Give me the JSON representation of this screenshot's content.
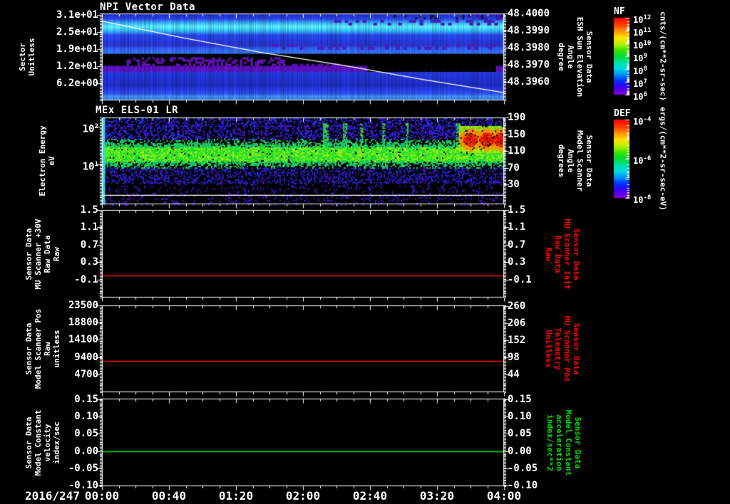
{
  "figure": {
    "background": "#000000"
  },
  "x_axis": {
    "date_label": "2016/247",
    "tick_labels": [
      "00:00",
      "00:40",
      "01:20",
      "02:00",
      "02:40",
      "03:20",
      "04:00"
    ],
    "minor_per_major": 4,
    "range_minutes": [
      0,
      240
    ]
  },
  "chart_data": [
    {
      "id": "npi",
      "type": "heatmap",
      "title": "NPI Vector Data",
      "left_axis": {
        "label_lines": [
          "Sector",
          "Unitless"
        ],
        "color": "#ffffff",
        "range": [
          31.64,
          0.03
        ],
        "ticks": [
          {
            "v": 31.25,
            "t": "3.1e+01"
          },
          {
            "v": 25.0,
            "t": "2.5e+01"
          },
          {
            "v": 18.75,
            "t": "1.9e+01"
          },
          {
            "v": 12.5,
            "t": "1.2e+01"
          },
          {
            "v": 6.25,
            "t": "6.2e+00"
          }
        ]
      },
      "right_axis": {
        "label_lines": [
          "Sensor Data",
          "ESH Sun Elevation",
          "Angle",
          "degree"
        ],
        "color": "#ffffff",
        "range": [
          48.40002,
          48.3949
        ],
        "ticks": [
          {
            "v": 48.4,
            "t": "48.4000"
          },
          {
            "v": 48.399,
            "t": "48.3990"
          },
          {
            "v": 48.398,
            "t": "48.3980"
          },
          {
            "v": 48.397,
            "t": "48.3970"
          },
          {
            "v": 48.396,
            "t": "48.3960"
          }
        ]
      },
      "colorbar": {
        "name": "NF",
        "unit": "cnts/(cm**2-sr-sec)",
        "tick_base": "10",
        "tick_exponents": [
          "12",
          "11",
          "10",
          "9",
          "8",
          "7",
          "6"
        ],
        "decades": 6
      },
      "overlay_line": {
        "name": "ESH Sun Elevation Angle",
        "color": "#ffffff",
        "axis": "right",
        "points": [
          [
            0,
            48.39956
          ],
          [
            0.2,
            48.39859
          ],
          [
            0.4,
            48.39771
          ],
          [
            0.6,
            48.39696
          ],
          [
            0.8,
            48.39612
          ],
          [
            1,
            48.39536
          ]
        ]
      },
      "bands": [
        [
          0.0,
          "#1f2dc6"
        ],
        [
          0.05,
          "#2a40dc"
        ],
        [
          0.09,
          "#2f9ce8"
        ],
        [
          0.139,
          "#58e4f8"
        ],
        [
          0.19,
          "#2fb4ec"
        ],
        [
          0.24,
          "#2744e0"
        ],
        [
          0.31,
          "#2238d2"
        ],
        [
          0.36,
          "#2a2fc0"
        ],
        [
          0.395,
          "#2c58e8"
        ],
        [
          0.45,
          "#3070ee"
        ],
        [
          0.467,
          "#000000"
        ],
        [
          0.59,
          "#000000"
        ],
        [
          0.61,
          "#5712b6"
        ],
        [
          0.66,
          "#5712b6"
        ],
        [
          0.68,
          "#2136d0"
        ],
        [
          0.78,
          "#1f2fc4"
        ],
        [
          0.82,
          "#1b28b4"
        ],
        [
          0.87,
          "#2238d6"
        ],
        [
          0.92,
          "#2d46e0"
        ],
        [
          0.96,
          "#3e8cec"
        ],
        [
          1.0,
          "#2f6ad8"
        ]
      ],
      "features": [
        {
          "x": [
            0.06,
            0.45
          ],
          "y": [
            0.5,
            0.59
          ],
          "color": "#6a14c8",
          "density": 0.45,
          "bw": 3,
          "bh": 3
        },
        {
          "x": [
            0.45,
            0.62
          ],
          "y": [
            0.575,
            0.645
          ],
          "color": "#5a10b8",
          "density": 0.55,
          "bw": 4,
          "bh": 3
        },
        {
          "x": [
            0.66,
            0.965
          ],
          "y": [
            0.595,
            0.668
          ],
          "color": "#000000",
          "density": 1,
          "bw": 9,
          "bh": 9
        },
        {
          "x": [
            0.55,
            1.0
          ],
          "y": [
            0.065,
            0.125
          ],
          "color": "#441cb4",
          "density": 0.32,
          "bw": 5,
          "bh": 4
        },
        {
          "x": [
            0.42,
            1.0
          ],
          "y": [
            0.345,
            0.4
          ],
          "color": "#4a1cb8",
          "density": 0.32,
          "bw": 5,
          "bh": 4
        },
        {
          "x": [
            0.93,
            1.0
          ],
          "y": [
            0.0,
            0.06
          ],
          "color": "#3a16a8",
          "density": 0.3,
          "bw": 4,
          "bh": 4
        },
        {
          "x": [
            0.72,
            1.0
          ],
          "y": [
            0.01,
            0.05
          ],
          "color": "#0a0a30",
          "density": 0.15,
          "bw": 3,
          "bh": 3
        }
      ]
    },
    {
      "id": "els",
      "type": "heatmap",
      "title": "MEx ELS-01 LR",
      "left_axis": {
        "label_lines": [
          "Electron Energy",
          "eV"
        ],
        "color": "#ffffff",
        "log": true,
        "range": [
          2.245,
          -0.057
        ],
        "ticks": [
          {
            "v": 2,
            "base": "10",
            "exp": "2"
          },
          {
            "v": 1,
            "base": "10",
            "exp": "1"
          }
        ]
      },
      "right_axis": {
        "label_lines": [
          "Sensor Data",
          "Model Scanner",
          "Angle",
          "degrees"
        ],
        "color": "#ffffff",
        "range": [
          190,
          -17.6
        ],
        "ticks": [
          {
            "v": 190,
            "t": "190"
          },
          {
            "v": 150,
            "t": "150"
          },
          {
            "v": 110,
            "t": "110"
          },
          {
            "v": 70,
            "t": "70"
          },
          {
            "v": 30,
            "t": "30"
          }
        ]
      },
      "colorbar": {
        "name": "DEF",
        "unit": "ergs/(cm**2-sr-sec-eV)",
        "tick_base": "10",
        "tick_exponents": [
          "-4",
          "-6",
          "-8"
        ],
        "decades": 4
      },
      "overlay_line": {
        "name": "Model Scanner Angle",
        "color": "#ffffff",
        "axis": "right",
        "points": [
          [
            0,
            4
          ],
          [
            1,
            4
          ]
        ]
      },
      "noise": {
        "regions": [
          {
            "y": [
              0.0,
              0.09
            ],
            "density": 0.5,
            "colors": [
              "#2a1ee0",
              "#3c12d0",
              "#2030cc",
              "#101060"
            ]
          },
          {
            "y": [
              0.09,
              0.24
            ],
            "density": 0.42,
            "colors": [
              "#2a1ee0",
              "#4a10d0",
              "#1b2cc8"
            ]
          },
          {
            "y": [
              0.575,
              0.75
            ],
            "density": 0.4,
            "colors": [
              "#2a1ee0",
              "#4a10d0",
              "#1b2cc8"
            ]
          },
          {
            "y": [
              0.75,
              1.0
            ],
            "density": 0.13,
            "colors": [
              "#3a14cc",
              "#2a1ee0",
              "#5a0dd8"
            ]
          }
        ],
        "band": {
          "y": [
            0.24,
            0.575
          ],
          "core_y": [
            0.33,
            0.5
          ],
          "core_colors": [
            "#2ee81e",
            "#55f01e",
            "#9cf01a",
            "#18d83c"
          ],
          "edge_colors": [
            "#14c86a",
            "#10b888",
            "#22dd44"
          ]
        },
        "streaks": [
          {
            "x": 0.555,
            "w": 0.012
          },
          {
            "x": 0.603,
            "w": 0.008
          },
          {
            "x": 0.645,
            "w": 0.006
          },
          {
            "x": 0.699,
            "w": 0.004
          },
          {
            "x": 0.757,
            "w": 0.004
          },
          {
            "x": 0.884,
            "w": 0.008
          }
        ],
        "streak_colors": [
          "#22dd55",
          "#10c878",
          "#66e818"
        ],
        "blob": {
          "x": [
            0.888,
            1.0
          ],
          "y": [
            0.09,
            0.4
          ],
          "base": "#a8e810",
          "cores": [
            0.915,
            0.955,
            0.99
          ],
          "core_colors": [
            "#f22000",
            "#ff4400",
            "#e80000"
          ],
          "ring": "#ff9900"
        },
        "left_column": {
          "x": [
            0,
            0.006
          ],
          "color": "#2ad8e8"
        }
      }
    },
    {
      "id": "mu-scanner-30v",
      "type": "line",
      "left_axis": {
        "label_lines": [
          "Sensor Data",
          "MU Scanner +30V",
          "Raw Data",
          "Raw"
        ],
        "color": "#ffffff",
        "range": [
          1.5,
          -0.51
        ],
        "ticks": [
          {
            "v": 1.5,
            "t": "1.5"
          },
          {
            "v": 1.1,
            "t": "1.1"
          },
          {
            "v": 0.7,
            "t": "0.7"
          },
          {
            "v": 0.3,
            "t": "0.3"
          },
          {
            "v": -0.1,
            "t": "-0.1"
          }
        ]
      },
      "right_axis": {
        "label_lines": [
          "Sensor Data",
          "MU Scanner Init",
          "Raw Data",
          "Raw"
        ],
        "color": "#ff0000",
        "range": [
          1.5,
          -0.51
        ],
        "ticks": [
          {
            "v": 1.5,
            "t": "1.5"
          },
          {
            "v": 1.1,
            "t": "1.1"
          },
          {
            "v": 0.7,
            "t": "0.7"
          },
          {
            "v": 0.3,
            "t": "0.3"
          },
          {
            "v": -0.1,
            "t": "-0.1"
          }
        ]
      },
      "series": [
        {
          "name": "MU Scanner +30V Raw",
          "color": "#ff0000",
          "value": 0.0
        }
      ]
    },
    {
      "id": "model-scanner-pos",
      "type": "line",
      "left_axis": {
        "label_lines": [
          "Sensor Data",
          "Model Scanner Pos",
          "Raw",
          "unitless"
        ],
        "color": "#ffffff",
        "range": [
          23500,
          -200
        ],
        "ticks": [
          {
            "v": 23500,
            "t": "23500"
          },
          {
            "v": 18800,
            "t": "18800"
          },
          {
            "v": 14100,
            "t": "14100"
          },
          {
            "v": 9400,
            "t": "9400"
          },
          {
            "v": 4700,
            "t": "4700"
          }
        ]
      },
      "right_axis": {
        "label_lines": [
          "Sensor Data",
          "MU Scanner Pos",
          "Telemetry",
          "Unitless"
        ],
        "color": "#ff0000",
        "range": [
          262,
          -12.5
        ],
        "ticks": [
          {
            "v": 260,
            "t": "260"
          },
          {
            "v": 206,
            "t": "206"
          },
          {
            "v": 152,
            "t": "152"
          },
          {
            "v": 98,
            "t": "98"
          },
          {
            "v": 44,
            "t": "44"
          }
        ]
      },
      "series": [
        {
          "name": "Model Scanner Pos Raw",
          "color": "#ff0000",
          "value": 8300
        }
      ]
    },
    {
      "id": "model-constant",
      "type": "line",
      "left_axis": {
        "label_lines": [
          "Sensor Data",
          "Model Constant",
          "velocity",
          "index/sec"
        ],
        "color": "#ffffff",
        "range": [
          0.152,
          -0.102
        ],
        "ticks": [
          {
            "v": 0.15,
            "t": "0.15"
          },
          {
            "v": 0.1,
            "t": "0.10"
          },
          {
            "v": 0.05,
            "t": "0.05"
          },
          {
            "v": 0.0,
            "t": "0.00"
          },
          {
            "v": -0.05,
            "t": "-0.05"
          },
          {
            "v": -0.1,
            "t": "-0.10"
          }
        ]
      },
      "right_axis": {
        "label_lines": [
          "Sensor Data",
          "Model Constant",
          "acceleration",
          "index/sec**2"
        ],
        "color": "#00e000",
        "range": [
          0.152,
          -0.102
        ],
        "ticks": [
          {
            "v": 0.15,
            "t": "0.15"
          },
          {
            "v": 0.1,
            "t": "0.10"
          },
          {
            "v": 0.05,
            "t": "0.05"
          },
          {
            "v": 0.0,
            "t": "0.00"
          },
          {
            "v": -0.05,
            "t": "-0.05"
          },
          {
            "v": -0.1,
            "t": "-0.10"
          }
        ]
      },
      "series": [
        {
          "name": "Model Constant velocity",
          "color": "#00e000",
          "value": 0.0
        }
      ]
    }
  ]
}
